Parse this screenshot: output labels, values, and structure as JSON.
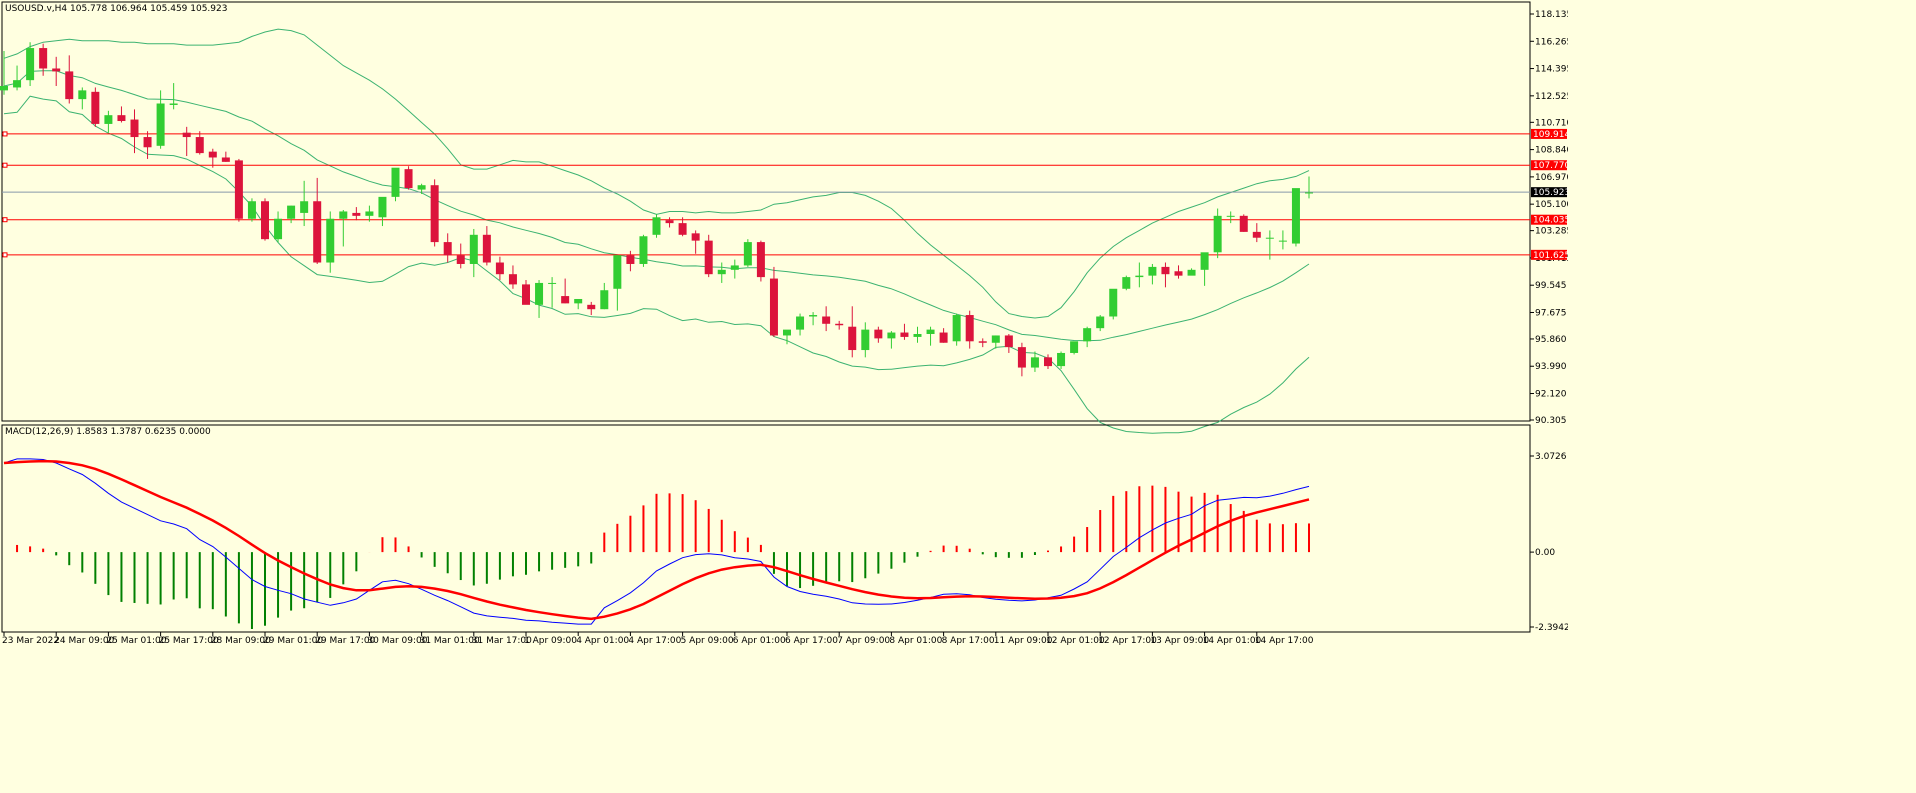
{
  "symbol_header": "USOUSD.v,H4  105.778 106.964 105.459 105.923",
  "macd_header": "MACD(12,26,9) 1.8583 1.3787 0.6235 0.0000",
  "colors": {
    "background": "#ffffe0",
    "bull": "#32cd32",
    "bear": "#dc143c",
    "bands": "#3cb371",
    "level": "#ff0000",
    "current_price_line": "#8899aa",
    "macd_line": "#0000ff",
    "signal_line": "#ff0000",
    "hist_pos": "#ff0000",
    "hist_neg": "#008000"
  },
  "chart_data": [
    {
      "type": "candlestick",
      "title": "USOUSD.v,H4",
      "y_ticks": [
        "118.135",
        "116.265",
        "114.395",
        "112.525",
        "110.710",
        "108.840",
        "106.970",
        "105.100",
        "103.285",
        "101.415",
        "99.545",
        "97.675",
        "95.860",
        "93.990",
        "92.120",
        "90.305"
      ],
      "ylim": [
        90.305,
        118.135
      ],
      "x_tick_labels": [
        "23 Mar 2022",
        "24 Mar 09:00",
        "25 Mar 01:00",
        "25 Mar 17:00",
        "28 Mar 09:00",
        "29 Mar 01:00",
        "29 Mar 17:00",
        "30 Mar 09:00",
        "31 Mar 01:00",
        "31 Mar 17:00",
        "1 Apr 09:00",
        "4 Apr 01:00",
        "4 Apr 17:00",
        "5 Apr 09:00",
        "6 Apr 01:00",
        "6 Apr 17:00",
        "7 Apr 09:00",
        "8 Apr 01:00",
        "8 Apr 17:00",
        "11 Apr 09:00",
        "12 Apr 01:00",
        "12 Apr 17:00",
        "13 Apr 09:00",
        "14 Apr 01:00",
        "14 Apr 17:00"
      ],
      "levels": [
        "109.914",
        "107.770",
        "104.035",
        "101.625"
      ],
      "current_price": "105.923",
      "candles_ohlc": [
        [
          112.9,
          115.6,
          112.6,
          113.2
        ],
        [
          113.1,
          114.6,
          112.9,
          113.6
        ],
        [
          113.6,
          116.2,
          113.2,
          115.8
        ],
        [
          115.8,
          116.1,
          113.9,
          114.4
        ],
        [
          114.4,
          115.2,
          113.2,
          114.2
        ],
        [
          114.2,
          115.3,
          112.0,
          112.3
        ],
        [
          112.3,
          113.1,
          111.6,
          112.9
        ],
        [
          112.8,
          113.1,
          110.4,
          110.6
        ],
        [
          110.6,
          111.5,
          110.0,
          111.2
        ],
        [
          111.2,
          111.8,
          110.7,
          110.8
        ],
        [
          110.9,
          111.6,
          108.6,
          109.7
        ],
        [
          109.7,
          110.1,
          108.2,
          109.0
        ],
        [
          109.1,
          112.9,
          108.9,
          112.0
        ],
        [
          111.9,
          113.4,
          111.6,
          112.0
        ],
        [
          110.0,
          110.4,
          108.4,
          109.7
        ],
        [
          109.7,
          110.1,
          108.5,
          108.6
        ],
        [
          108.7,
          108.9,
          107.6,
          108.3
        ],
        [
          108.3,
          108.7,
          108.0,
          108.0
        ],
        [
          108.1,
          108.2,
          103.9,
          104.1
        ],
        [
          104.1,
          105.5,
          103.9,
          105.3
        ],
        [
          105.3,
          105.5,
          102.6,
          102.7
        ],
        [
          102.7,
          104.6,
          102.5,
          104.1
        ],
        [
          104.1,
          105.0,
          103.8,
          105.0
        ],
        [
          104.5,
          106.7,
          103.6,
          105.3
        ],
        [
          105.3,
          106.9,
          101.0,
          101.1
        ],
        [
          101.1,
          104.6,
          100.4,
          104.1
        ],
        [
          104.1,
          104.7,
          102.2,
          104.6
        ],
        [
          104.5,
          104.9,
          104.0,
          104.3
        ],
        [
          104.3,
          105.0,
          103.9,
          104.6
        ],
        [
          104.2,
          105.2,
          103.6,
          105.6
        ],
        [
          105.6,
          107.1,
          105.3,
          107.6
        ],
        [
          107.5,
          107.7,
          106.1,
          106.2
        ],
        [
          106.1,
          106.5,
          105.8,
          106.4
        ],
        [
          106.4,
          106.8,
          102.2,
          102.5
        ],
        [
          102.5,
          103.1,
          101.1,
          101.6
        ],
        [
          101.6,
          102.4,
          100.7,
          101.0
        ],
        [
          101.0,
          103.4,
          100.1,
          103.0
        ],
        [
          103.0,
          103.6,
          100.9,
          101.1
        ],
        [
          101.1,
          101.5,
          99.9,
          100.3
        ],
        [
          100.3,
          100.9,
          99.3,
          99.6
        ],
        [
          99.6,
          99.9,
          98.4,
          98.2
        ],
        [
          98.2,
          99.9,
          97.3,
          99.7
        ],
        [
          99.7,
          100.1,
          98.0,
          99.7
        ],
        [
          98.8,
          100.0,
          98.3,
          98.3
        ],
        [
          98.3,
          98.6,
          97.9,
          98.6
        ],
        [
          98.2,
          98.4,
          97.5,
          97.9
        ],
        [
          97.9,
          99.7,
          97.9,
          99.2
        ],
        [
          99.3,
          101.6,
          97.8,
          101.6
        ],
        [
          101.6,
          101.9,
          100.5,
          101.0
        ],
        [
          101.0,
          103.0,
          100.8,
          102.9
        ],
        [
          103.0,
          104.4,
          102.8,
          104.2
        ],
        [
          104.0,
          104.2,
          103.5,
          103.8
        ],
        [
          103.8,
          104.2,
          102.9,
          103.0
        ],
        [
          103.1,
          103.3,
          101.7,
          102.6
        ],
        [
          102.6,
          103.0,
          100.1,
          100.3
        ],
        [
          100.3,
          101.1,
          99.7,
          100.6
        ],
        [
          100.6,
          101.3,
          100.0,
          100.9
        ],
        [
          100.9,
          102.7,
          100.8,
          102.5
        ],
        [
          102.5,
          102.6,
          99.8,
          100.1
        ],
        [
          100.0,
          100.8,
          96.0,
          96.1
        ],
        [
          96.1,
          96.4,
          95.5,
          96.5
        ],
        [
          96.5,
          97.6,
          96.1,
          97.4
        ],
        [
          97.4,
          97.7,
          96.8,
          97.5
        ],
        [
          97.4,
          98.1,
          96.4,
          96.9
        ],
        [
          96.9,
          97.1,
          96.5,
          96.8
        ],
        [
          96.7,
          98.1,
          94.6,
          95.1
        ],
        [
          95.1,
          97.0,
          94.6,
          96.5
        ],
        [
          96.5,
          96.7,
          95.6,
          95.9
        ],
        [
          95.9,
          96.4,
          95.2,
          96.3
        ],
        [
          96.3,
          96.9,
          95.8,
          96.0
        ],
        [
          96.0,
          96.7,
          95.6,
          96.2
        ],
        [
          96.2,
          96.7,
          95.4,
          96.5
        ],
        [
          96.3,
          96.6,
          95.6,
          95.6
        ],
        [
          95.7,
          97.6,
          95.4,
          97.5
        ],
        [
          97.5,
          97.8,
          95.2,
          95.7
        ],
        [
          95.7,
          95.9,
          95.3,
          95.6
        ],
        [
          95.6,
          96.1,
          95.2,
          96.1
        ],
        [
          96.1,
          96.2,
          94.9,
          95.3
        ],
        [
          95.3,
          95.6,
          93.3,
          93.9
        ],
        [
          93.9,
          95.0,
          93.6,
          94.6
        ],
        [
          94.6,
          94.8,
          93.8,
          94.0
        ],
        [
          94.0,
          95.0,
          93.8,
          94.9
        ],
        [
          94.9,
          95.6,
          94.8,
          95.7
        ],
        [
          95.7,
          96.7,
          95.3,
          96.6
        ],
        [
          96.6,
          97.5,
          96.4,
          97.4
        ],
        [
          97.4,
          99.2,
          97.2,
          99.3
        ],
        [
          99.3,
          100.2,
          99.2,
          100.1
        ],
        [
          100.1,
          101.1,
          99.4,
          100.2
        ],
        [
          100.2,
          101.0,
          99.6,
          100.8
        ],
        [
          100.8,
          101.1,
          99.4,
          100.3
        ],
        [
          100.5,
          100.9,
          100.0,
          100.2
        ],
        [
          100.2,
          100.7,
          100.4,
          100.6
        ],
        [
          100.6,
          101.3,
          99.5,
          101.8
        ],
        [
          101.8,
          104.8,
          101.4,
          104.3
        ],
        [
          104.3,
          104.6,
          103.8,
          104.3
        ],
        [
          104.3,
          104.4,
          103.2,
          103.2
        ],
        [
          103.2,
          103.8,
          102.5,
          102.8
        ],
        [
          102.8,
          103.3,
          101.3,
          102.8
        ],
        [
          102.6,
          103.3,
          102.0,
          102.6
        ],
        [
          102.4,
          105.7,
          102.2,
          106.2
        ],
        [
          105.9,
          107.0,
          105.5,
          105.9
        ]
      ],
      "bollinger_upper": [
        115.1,
        115.4,
        115.9,
        116.2,
        116.3,
        116.4,
        116.3,
        116.3,
        116.3,
        116.2,
        116.2,
        116.1,
        116.1,
        116.1,
        116.0,
        116.0,
        116.0,
        116.1,
        116.2,
        116.6,
        116.9,
        117.1,
        117.0,
        116.7,
        116.0,
        115.3,
        114.6,
        114.1,
        113.6,
        113.0,
        112.3,
        111.5,
        110.7,
        109.9,
        108.9,
        107.8,
        107.5,
        107.5,
        107.8,
        108.1,
        108.0,
        108.0,
        107.7,
        107.4,
        107.1,
        106.7,
        106.2,
        105.8,
        105.3,
        104.7,
        104.4,
        104.6,
        104.6,
        104.5,
        104.6,
        104.5,
        104.5,
        104.6,
        104.7,
        105.1,
        105.2,
        105.4,
        105.6,
        105.7,
        105.9,
        105.9,
        105.7,
        105.3,
        104.8,
        104.0,
        103.1,
        102.3,
        101.6,
        100.9,
        100.2,
        99.4,
        98.4,
        97.6,
        97.4,
        97.3,
        97.4,
        98.0,
        99.1,
        100.4,
        101.4,
        102.2,
        102.8,
        103.3,
        103.8,
        104.2,
        104.6,
        104.9,
        105.2,
        105.6,
        105.9,
        106.2,
        106.5,
        106.7,
        106.8,
        107.0,
        107.4
      ]
    },
    {
      "type": "macd",
      "title": "MACD(12,26,9)",
      "y_ticks": [
        "3.0726",
        "0.00",
        "-2.3942"
      ],
      "ylim": [
        -2.3942,
        3.0726
      ],
      "macd_line": [
        2.85,
        2.98,
        2.98,
        2.96,
        2.85,
        2.66,
        2.48,
        2.2,
        1.88,
        1.6,
        1.4,
        1.2,
        1.0,
        0.9,
        0.75,
        0.4,
        0.18,
        -0.16,
        -0.52,
        -0.88,
        -1.1,
        -1.22,
        -1.33,
        -1.5,
        -1.6,
        -1.7,
        -1.62,
        -1.5,
        -1.22,
        -0.95,
        -0.9,
        -1.01,
        -1.19,
        -1.38,
        -1.55,
        -1.75,
        -1.95,
        -2.04,
        -2.08,
        -2.12,
        -2.18,
        -2.2,
        -2.24,
        -2.27,
        -2.3,
        -2.3,
        -1.78,
        -1.55,
        -1.3,
        -0.98,
        -0.6,
        -0.38,
        -0.18,
        -0.08,
        -0.05,
        -0.09,
        -0.18,
        -0.22,
        -0.3,
        -0.8,
        -1.1,
        -1.26,
        -1.35,
        -1.41,
        -1.5,
        -1.62,
        -1.66,
        -1.67,
        -1.66,
        -1.61,
        -1.54,
        -1.45,
        -1.35,
        -1.33,
        -1.36,
        -1.45,
        -1.51,
        -1.54,
        -1.56,
        -1.53,
        -1.46,
        -1.38,
        -1.18,
        -0.95,
        -0.55,
        -0.14,
        0.15,
        0.46,
        0.71,
        0.93,
        1.08,
        1.21,
        1.48,
        1.66,
        1.7,
        1.75,
        1.74,
        1.79,
        1.88,
        2.0,
        2.1
      ]
    }
  ]
}
